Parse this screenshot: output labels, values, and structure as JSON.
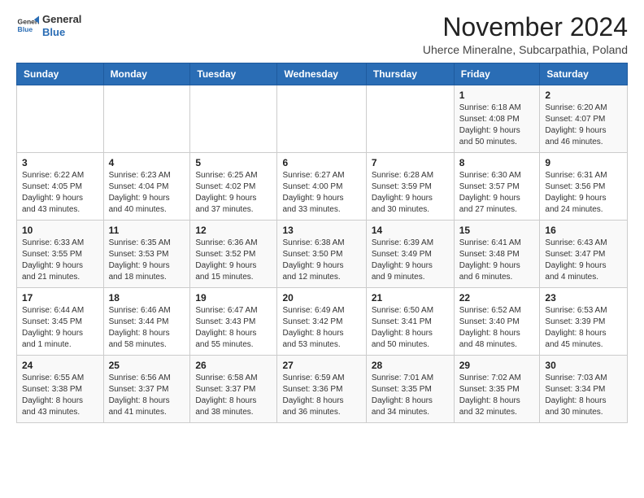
{
  "header": {
    "logo_line1": "General",
    "logo_line2": "Blue",
    "month_title": "November 2024",
    "location": "Uherce Mineralne, Subcarpathia, Poland"
  },
  "weekdays": [
    "Sunday",
    "Monday",
    "Tuesday",
    "Wednesday",
    "Thursday",
    "Friday",
    "Saturday"
  ],
  "weeks": [
    [
      {
        "day": "",
        "info": ""
      },
      {
        "day": "",
        "info": ""
      },
      {
        "day": "",
        "info": ""
      },
      {
        "day": "",
        "info": ""
      },
      {
        "day": "",
        "info": ""
      },
      {
        "day": "1",
        "info": "Sunrise: 6:18 AM\nSunset: 4:08 PM\nDaylight: 9 hours\nand 50 minutes."
      },
      {
        "day": "2",
        "info": "Sunrise: 6:20 AM\nSunset: 4:07 PM\nDaylight: 9 hours\nand 46 minutes."
      }
    ],
    [
      {
        "day": "3",
        "info": "Sunrise: 6:22 AM\nSunset: 4:05 PM\nDaylight: 9 hours\nand 43 minutes."
      },
      {
        "day": "4",
        "info": "Sunrise: 6:23 AM\nSunset: 4:04 PM\nDaylight: 9 hours\nand 40 minutes."
      },
      {
        "day": "5",
        "info": "Sunrise: 6:25 AM\nSunset: 4:02 PM\nDaylight: 9 hours\nand 37 minutes."
      },
      {
        "day": "6",
        "info": "Sunrise: 6:27 AM\nSunset: 4:00 PM\nDaylight: 9 hours\nand 33 minutes."
      },
      {
        "day": "7",
        "info": "Sunrise: 6:28 AM\nSunset: 3:59 PM\nDaylight: 9 hours\nand 30 minutes."
      },
      {
        "day": "8",
        "info": "Sunrise: 6:30 AM\nSunset: 3:57 PM\nDaylight: 9 hours\nand 27 minutes."
      },
      {
        "day": "9",
        "info": "Sunrise: 6:31 AM\nSunset: 3:56 PM\nDaylight: 9 hours\nand 24 minutes."
      }
    ],
    [
      {
        "day": "10",
        "info": "Sunrise: 6:33 AM\nSunset: 3:55 PM\nDaylight: 9 hours\nand 21 minutes."
      },
      {
        "day": "11",
        "info": "Sunrise: 6:35 AM\nSunset: 3:53 PM\nDaylight: 9 hours\nand 18 minutes."
      },
      {
        "day": "12",
        "info": "Sunrise: 6:36 AM\nSunset: 3:52 PM\nDaylight: 9 hours\nand 15 minutes."
      },
      {
        "day": "13",
        "info": "Sunrise: 6:38 AM\nSunset: 3:50 PM\nDaylight: 9 hours\nand 12 minutes."
      },
      {
        "day": "14",
        "info": "Sunrise: 6:39 AM\nSunset: 3:49 PM\nDaylight: 9 hours\nand 9 minutes."
      },
      {
        "day": "15",
        "info": "Sunrise: 6:41 AM\nSunset: 3:48 PM\nDaylight: 9 hours\nand 6 minutes."
      },
      {
        "day": "16",
        "info": "Sunrise: 6:43 AM\nSunset: 3:47 PM\nDaylight: 9 hours\nand 4 minutes."
      }
    ],
    [
      {
        "day": "17",
        "info": "Sunrise: 6:44 AM\nSunset: 3:45 PM\nDaylight: 9 hours\nand 1 minute."
      },
      {
        "day": "18",
        "info": "Sunrise: 6:46 AM\nSunset: 3:44 PM\nDaylight: 8 hours\nand 58 minutes."
      },
      {
        "day": "19",
        "info": "Sunrise: 6:47 AM\nSunset: 3:43 PM\nDaylight: 8 hours\nand 55 minutes."
      },
      {
        "day": "20",
        "info": "Sunrise: 6:49 AM\nSunset: 3:42 PM\nDaylight: 8 hours\nand 53 minutes."
      },
      {
        "day": "21",
        "info": "Sunrise: 6:50 AM\nSunset: 3:41 PM\nDaylight: 8 hours\nand 50 minutes."
      },
      {
        "day": "22",
        "info": "Sunrise: 6:52 AM\nSunset: 3:40 PM\nDaylight: 8 hours\nand 48 minutes."
      },
      {
        "day": "23",
        "info": "Sunrise: 6:53 AM\nSunset: 3:39 PM\nDaylight: 8 hours\nand 45 minutes."
      }
    ],
    [
      {
        "day": "24",
        "info": "Sunrise: 6:55 AM\nSunset: 3:38 PM\nDaylight: 8 hours\nand 43 minutes."
      },
      {
        "day": "25",
        "info": "Sunrise: 6:56 AM\nSunset: 3:37 PM\nDaylight: 8 hours\nand 41 minutes."
      },
      {
        "day": "26",
        "info": "Sunrise: 6:58 AM\nSunset: 3:37 PM\nDaylight: 8 hours\nand 38 minutes."
      },
      {
        "day": "27",
        "info": "Sunrise: 6:59 AM\nSunset: 3:36 PM\nDaylight: 8 hours\nand 36 minutes."
      },
      {
        "day": "28",
        "info": "Sunrise: 7:01 AM\nSunset: 3:35 PM\nDaylight: 8 hours\nand 34 minutes."
      },
      {
        "day": "29",
        "info": "Sunrise: 7:02 AM\nSunset: 3:35 PM\nDaylight: 8 hours\nand 32 minutes."
      },
      {
        "day": "30",
        "info": "Sunrise: 7:03 AM\nSunset: 3:34 PM\nDaylight: 8 hours\nand 30 minutes."
      }
    ]
  ]
}
